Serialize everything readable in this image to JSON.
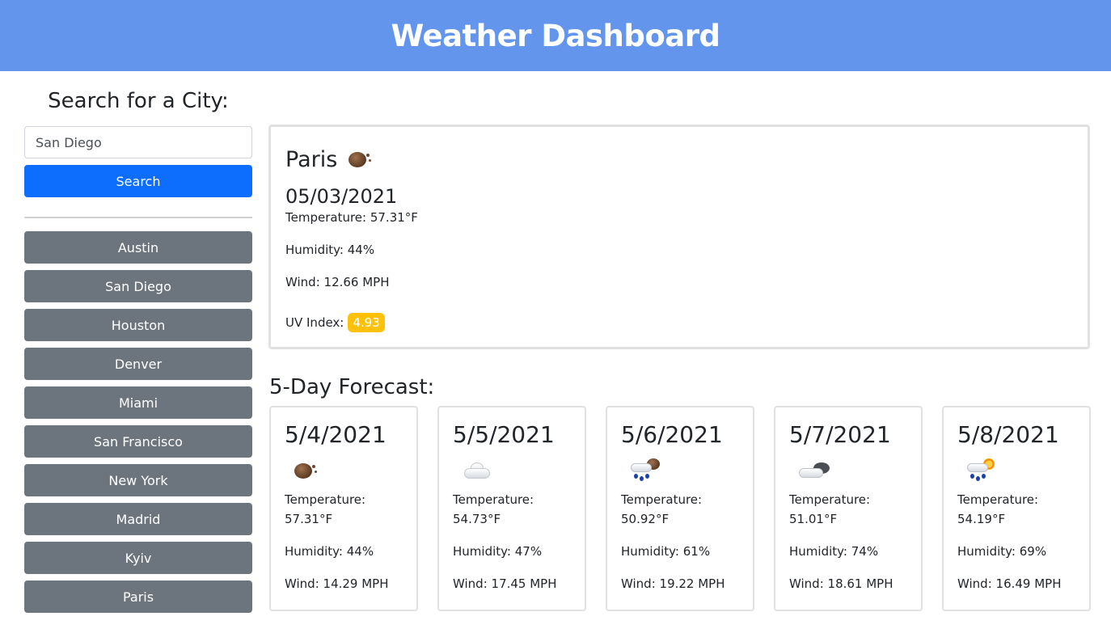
{
  "header": {
    "title": "Weather Dashboard"
  },
  "sidebar": {
    "heading": "Search for a City:",
    "search": {
      "value": "San Diego",
      "placeholder": ""
    },
    "search_button": "Search",
    "cities": [
      "Austin",
      "San Diego",
      "Houston",
      "Denver",
      "Miami",
      "San Francisco",
      "New York",
      "Madrid",
      "Kyiv",
      "Paris"
    ]
  },
  "current": {
    "city": "Paris",
    "icon": "dust-icon",
    "date": "05/03/2021",
    "temperature": "Temperature: 57.31°F",
    "humidity": "Humidity: 44%",
    "wind": "Wind: 12.66 MPH",
    "uv_label": "UV Index:",
    "uv_value": "4.93",
    "uv_color": "#ffc107"
  },
  "forecast": {
    "title": "5-Day Forecast:",
    "days": [
      {
        "date": "5/4/2021",
        "icon": "dust-icon",
        "temp_label": "Temperature:",
        "temp": "57.31°F",
        "humidity": "Humidity: 44%",
        "wind": "Wind: 14.29 MPH"
      },
      {
        "date": "5/5/2021",
        "icon": "cloud-icon",
        "temp_label": "Temperature:",
        "temp": "54.73°F",
        "humidity": "Humidity: 47%",
        "wind": "Wind: 17.45 MPH"
      },
      {
        "date": "5/6/2021",
        "icon": "rain-dust-icon",
        "temp_label": "Temperature:",
        "temp": "50.92°F",
        "humidity": "Humidity: 61%",
        "wind": "Wind: 19.22 MPH"
      },
      {
        "date": "5/7/2021",
        "icon": "overcast-clouds-icon",
        "temp_label": "Temperature:",
        "temp": "51.01°F",
        "humidity": "Humidity: 74%",
        "wind": "Wind: 18.61 MPH"
      },
      {
        "date": "5/8/2021",
        "icon": "rain-sun-icon",
        "temp_label": "Temperature:",
        "temp": "54.19°F",
        "humidity": "Humidity: 69%",
        "wind": "Wind: 16.49 MPH"
      }
    ]
  },
  "colors": {
    "header_bg": "#6495ed",
    "primary_button": "#0d6efd",
    "city_button": "#6c757d",
    "uv_badge": "#ffc107"
  }
}
